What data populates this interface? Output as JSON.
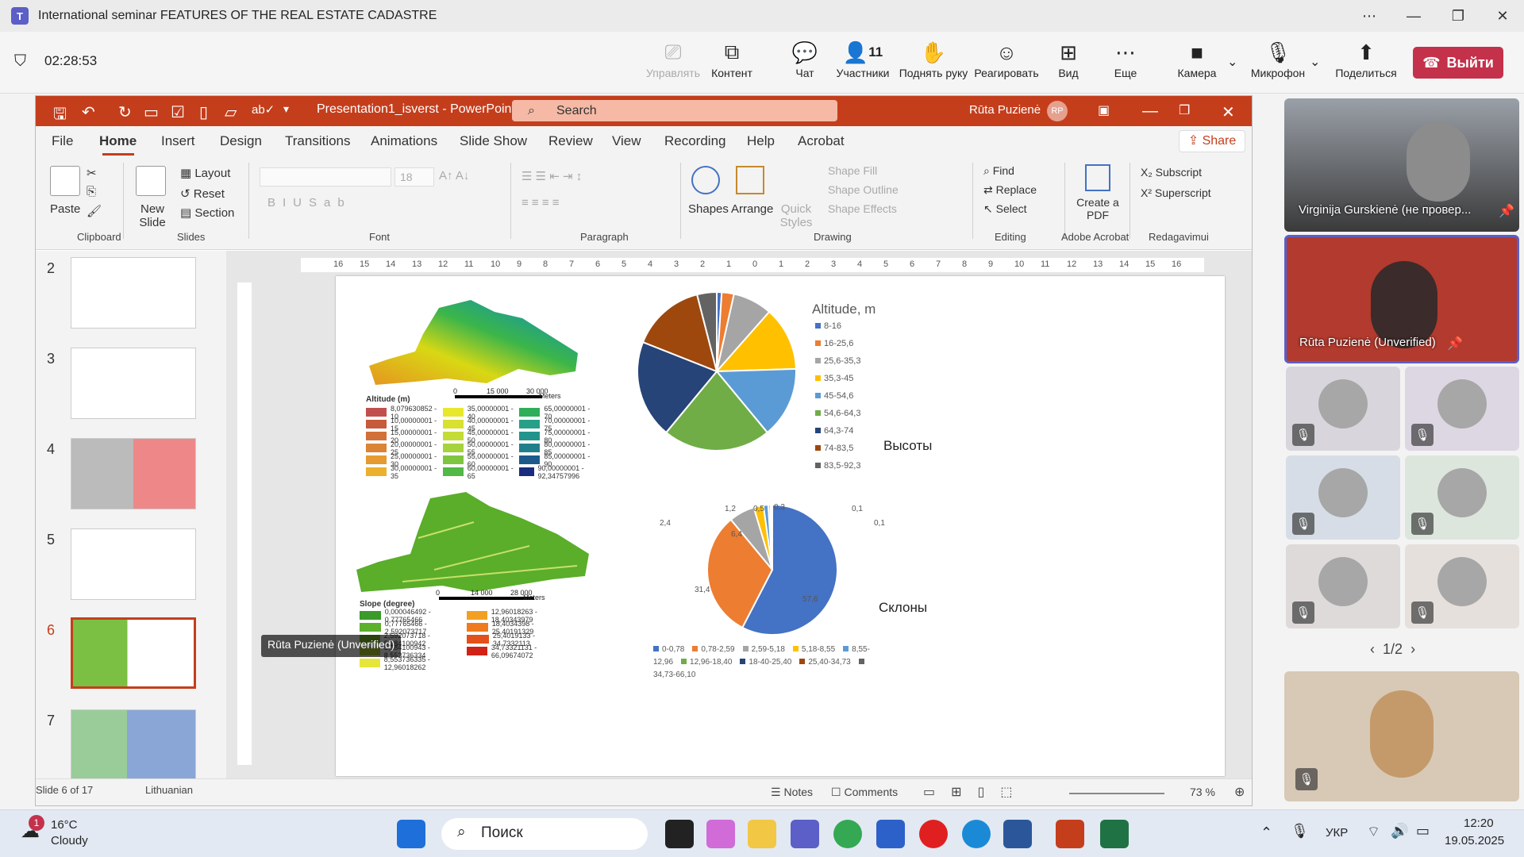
{
  "teams": {
    "title": "International seminar FEATURES OF THE REAL ESTATE CADASTRE",
    "timer": "02:28:53",
    "tools": [
      {
        "label": "Управлять",
        "icon": "share-screen-icon"
      },
      {
        "label": "Контент",
        "icon": "content-icon"
      },
      {
        "label": "Чат",
        "icon": "chat-icon"
      },
      {
        "label": "Участники",
        "icon": "people-icon",
        "count": "11"
      },
      {
        "label": "Поднять руку",
        "icon": "raise-hand-icon"
      },
      {
        "label": "Реагировать",
        "icon": "react-icon"
      },
      {
        "label": "Вид",
        "icon": "view-icon"
      },
      {
        "label": "Еще",
        "icon": "more-icon"
      },
      {
        "label": "Камера",
        "icon": "camera-icon"
      },
      {
        "label": "Микрофон",
        "icon": "mic-off-icon"
      },
      {
        "label": "Поделиться",
        "icon": "share-icon"
      }
    ],
    "leave": "Выйти",
    "accent": "#c4314b"
  },
  "ppt": {
    "filename": "Presentation1_isverst",
    "app": "PowerPoint",
    "search": "Search",
    "user": "Rūta Puzienė",
    "initials": "RP",
    "tabs": [
      "File",
      "Home",
      "Insert",
      "Design",
      "Transitions",
      "Animations",
      "Slide Show",
      "Review",
      "View",
      "Recording",
      "Help",
      "Acrobat"
    ],
    "share": "Share",
    "ribbon": {
      "paste": "Paste",
      "new_slide": "New Slide",
      "layout": "Layout",
      "reset": "Reset",
      "section": "Section",
      "font_size": "18",
      "shapes": "Shapes",
      "arrange": "Arrange",
      "quick_styles": "Quick Styles",
      "shape_fill": "Shape Fill",
      "shape_outline": "Shape Outline",
      "shape_effects": "Shape Effects",
      "find": "Find",
      "replace": "Replace",
      "select": "Select",
      "create_pdf": "Create a PDF",
      "subscript": "Subscript",
      "superscript": "Superscript",
      "groups": [
        "Clipboard",
        "Slides",
        "Font",
        "Paragraph",
        "Drawing",
        "Editing",
        "Adobe Acrobat",
        "Redagavimui"
      ]
    },
    "thumb_numbers": [
      "2",
      "3",
      "4",
      "5",
      "6",
      "7"
    ],
    "status": {
      "slide": "Slide 6 of 17",
      "lang": "Lithuanian",
      "notes": "Notes",
      "comments": "Comments",
      "zoom": "73 %"
    },
    "presenter_label": "Rūta Puzienė (Unverified)"
  },
  "slide": {
    "alt_legend_title": "Altitude, m",
    "alt_legend": [
      {
        "label": "8-16",
        "color": "#4472c4"
      },
      {
        "label": "16-25,6",
        "color": "#ed7d31"
      },
      {
        "label": "25,6-35,3",
        "color": "#a5a5a5"
      },
      {
        "label": "35,3-45",
        "color": "#ffc000"
      },
      {
        "label": "45-54,6",
        "color": "#5b9bd5"
      },
      {
        "label": "54,6-64,3",
        "color": "#70ad47"
      },
      {
        "label": "64,3-74",
        "color": "#264478"
      },
      {
        "label": "74-83,5",
        "color": "#9e480e"
      },
      {
        "label": "83,5-92,3",
        "color": "#636363"
      }
    ],
    "heights_label": "Высоты",
    "slopes_label": "Склоны",
    "map1_title": "Altitude (m)",
    "map1_scale": [
      "0",
      "15 000",
      "30 000",
      "Meters"
    ],
    "map1_legend": [
      [
        "8,079630852 - 10",
        "35,00000001 - 40",
        "65,00000001 - 70"
      ],
      [
        "10,00000001 - 15",
        "40,00000001 - 45",
        "70,00000001 - 75"
      ],
      [
        "15,00000001 - 20",
        "45,00000001 - 50",
        "75,00000001 - 80"
      ],
      [
        "20,00000001 - 25",
        "50,00000001 - 55",
        "80,00000001 - 85"
      ],
      [
        "25,00000001 - 30",
        "55,00000001 - 60",
        "85,00000001 - 90"
      ],
      [
        "30,00000001 - 35",
        "60,00000001 - 65",
        "90,00000001 - 92,34757996"
      ]
    ],
    "map2_title": "Slope (degree)",
    "map2_scale": [
      "0",
      "14 000",
      "28 000",
      "Meters"
    ],
    "map2_legend": [
      [
        "0,000046492 - 0,77765466",
        "12,96018263 - 18,40343979"
      ],
      [
        "0,77765466 - 2,592073717",
        "18,4034398 - 25,40191329"
      ],
      [
        "2,592073718 - 5,184100942",
        "25,4019133 - 34,7332113"
      ],
      [
        "5,184100943 - 8,553736334",
        "34,73321131 - 66,09674072"
      ],
      [
        "8,553736335 - 12,96018262",
        ""
      ]
    ],
    "slope_legend": [
      "0-0,78",
      "0,78-2,59",
      "2,59-5,18",
      "5,18-8,55",
      "8,55-12,96",
      "12,96-18,40",
      "18-40-25,40",
      "25,40-34,73",
      "34,73-66,10"
    ],
    "slope_labels": [
      "2,4",
      "1,2",
      "0,5",
      "0,3",
      "0,1",
      "0,1",
      "6,4",
      "31,4",
      "57,6"
    ]
  },
  "chart_data": [
    {
      "type": "pie",
      "title": "Altitude, m",
      "categories": [
        "8-16",
        "16-25,6",
        "25,6-35,3",
        "35,3-45",
        "45-54,6",
        "54,6-64,3",
        "64,3-74",
        "74-83,5",
        "83,5-92,3"
      ],
      "values": [
        1,
        2.5,
        8,
        13,
        14.5,
        22,
        20,
        15,
        4
      ]
    },
    {
      "type": "pie",
      "title": "",
      "categories": [
        "0-0,78",
        "0,78-2,59",
        "2,59-5,18",
        "5,18-8,55",
        "8,55-12,96",
        "12,96-18,40",
        "18-40-25,40",
        "25,40-34,73",
        "34,73-66,10"
      ],
      "values": [
        57.6,
        31.4,
        6.4,
        2.4,
        1.2,
        0.5,
        0.3,
        0.1,
        0.1
      ]
    }
  ],
  "gallery": {
    "p1": "Virginija Gurskienė (не провер...",
    "p2": "Rūta Puzienė (Unverified)",
    "page": "1/2"
  },
  "taskbar": {
    "temp": "16°C",
    "weather": "Cloudy",
    "search": "Поиск",
    "lang": "УКР",
    "time": "12:20",
    "date": "19.05.2025",
    "badge": "1"
  }
}
